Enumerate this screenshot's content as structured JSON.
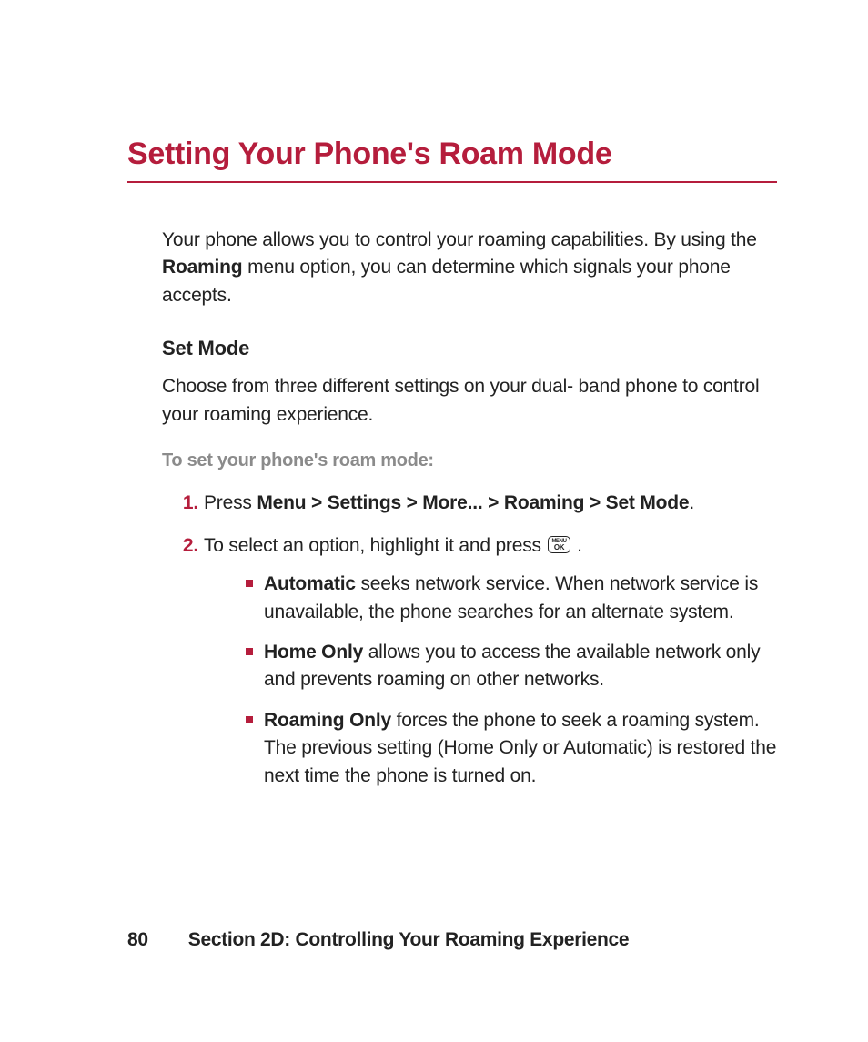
{
  "title": "Setting Your Phone's Roam Mode",
  "intro": {
    "pre": "Your phone allows you to control your roaming capabilities. By using the ",
    "bold": "Roaming",
    "post": " menu option, you can determine which signals your phone accepts."
  },
  "set_mode": {
    "heading": "Set Mode",
    "desc": "Choose from three different settings on your dual- band phone to control your roaming experience.",
    "procedure_label": "To set your phone's roam mode:"
  },
  "steps": {
    "s1": {
      "pre": "Press ",
      "bold": "Menu > Settings > More... > Roaming > Set Mode",
      "post": "."
    },
    "s2": {
      "pre": "To select an option, highlight it and press ",
      "key_top": "MENU",
      "key_bot": "OK",
      "post": " ."
    }
  },
  "bullets": {
    "b1": {
      "bold": "Automatic",
      "rest": " seeks network service. When network service is unavailable, the phone searches for an alternate system."
    },
    "b2": {
      "bold": "Home Only",
      "rest": " allows you to access the available network only and prevents roaming on other networks."
    },
    "b3": {
      "bold": "Roaming Only",
      "rest": " forces the phone to seek a roaming system. The previous setting (Home Only or Automatic) is restored the next time the phone is turned on."
    }
  },
  "footer": {
    "page": "80",
    "section": "Section 2D: Controlling Your Roaming Experience"
  }
}
